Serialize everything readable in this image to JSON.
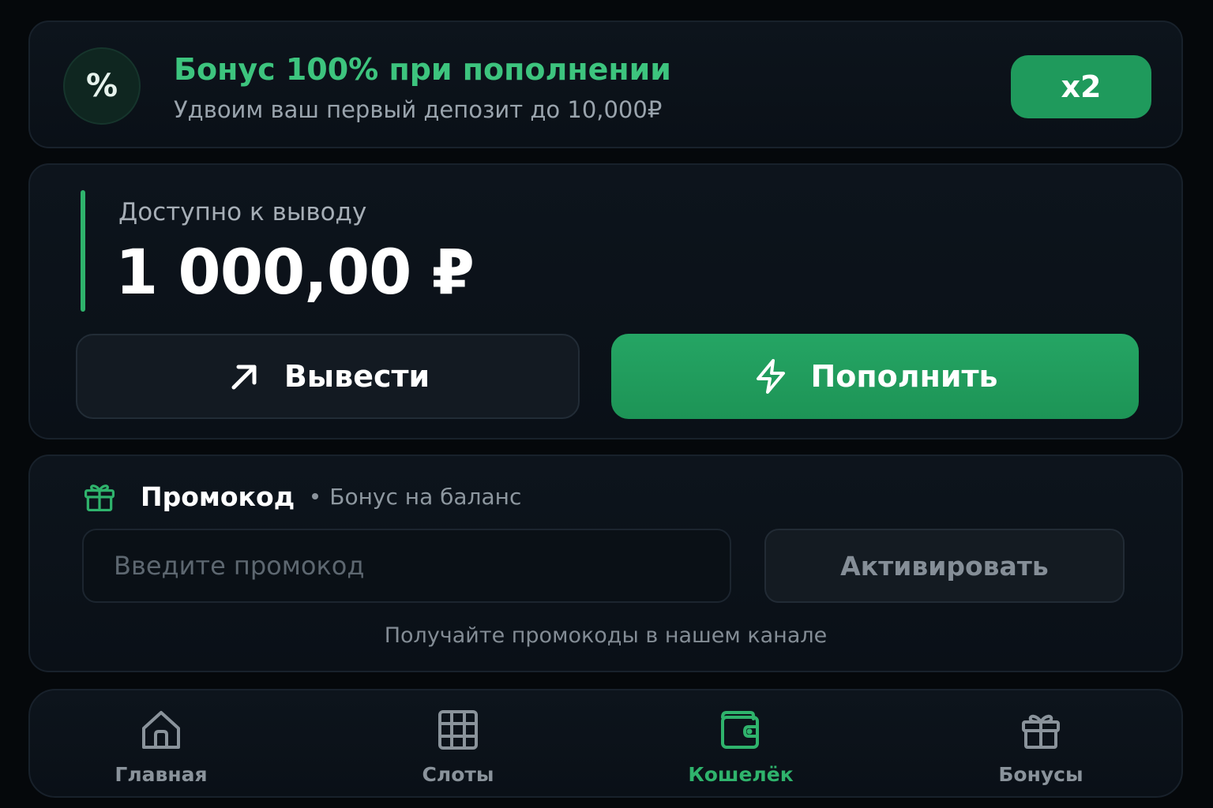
{
  "bonus_banner": {
    "icon": "percent-icon",
    "icon_text": "%",
    "title": "Бонус 100% при пополнении",
    "subtitle": "Удвоим ваш первый депозит до 10,000₽",
    "badge": "x2"
  },
  "balance": {
    "label": "Доступно к выводу",
    "amount": "1 000,00 ₽",
    "withdraw_label": "Вывести",
    "withdraw_icon": "arrow-up-right-icon",
    "deposit_label": "Пополнить",
    "deposit_icon": "lightning-icon"
  },
  "promo": {
    "icon": "gift-icon",
    "title": "Промокод",
    "subtitle": "Бонус на баланс",
    "input_value": "",
    "input_placeholder": "Введите промокод",
    "activate_label": "Активировать",
    "hint": "Получайте промокоды в нашем канале"
  },
  "nav": {
    "items": [
      {
        "label": "Главная",
        "icon": "home-icon",
        "active": false
      },
      {
        "label": "Слоты",
        "icon": "grid-icon",
        "active": false
      },
      {
        "label": "Кошелёк",
        "icon": "wallet-icon",
        "active": true
      },
      {
        "label": "Бонусы",
        "icon": "gift-icon",
        "active": false
      }
    ]
  },
  "colors": {
    "background": "#05080b",
    "card": "#0d141c",
    "accent": "#2fb36c",
    "accent_button": "#1f9a5c",
    "title_green": "#3dc47e",
    "muted_text": "#8a939b"
  }
}
